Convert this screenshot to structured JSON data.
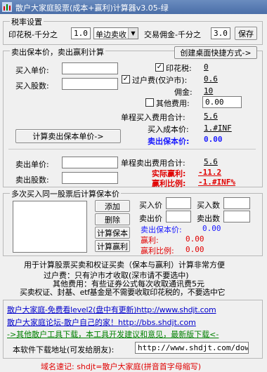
{
  "window": {
    "title": "散户大家庭股票(成本+赢利)计算器v3.05-绿"
  },
  "tax": {
    "group_label": "税率设置",
    "stamp_label": "印花税-千分之",
    "stamp_value": "1.0",
    "direction_selected": "单边卖收",
    "commission_label": "交易佣金-千分之",
    "commission_value": "3.0",
    "save_label": "保存"
  },
  "breakeven": {
    "group_label": "卖出保本价，卖出赢利计算",
    "shortcut_label": "创建桌面快捷方式->",
    "buy_price_label": "买入单价:",
    "buy_price_value": "",
    "buy_qty_label": "买入股数:",
    "buy_qty_value": "",
    "stamp_check_label": "印花税:",
    "stamp_amount": "0",
    "transfer_check_label": "过户费(仅沪市):",
    "transfer_amount": "0.6",
    "commission_label": "佣金:",
    "commission_amount": "10",
    "other_check_label": "其他费用:",
    "other_amount": "0.00",
    "unit_buy_fee_label": "单程买入费用合计:",
    "unit_buy_fee_value": "5.6",
    "buy_cost_label": "买入成本价:",
    "buy_cost_value": "1.#INF",
    "calc_button_label": "计算卖出保本单价->",
    "breakeven_label": "卖出保本价:",
    "breakeven_value": "0.00",
    "sell_price_label": "卖出单价:",
    "sell_price_value": "",
    "sell_qty_label": "卖出股数:",
    "sell_qty_value": "",
    "unit_sell_fee_label": "单程卖出费用合计:",
    "unit_sell_fee_value": "5.6",
    "actual_profit_label": "实际赢利:",
    "actual_profit_value": "-11.2",
    "profit_ratio_label": "赢利比例:",
    "profit_ratio_value": "-1.#INF%"
  },
  "multi": {
    "group_label": "多次买入同一股票后计算保本价",
    "add_label": "添加",
    "delete_label": "删除",
    "calc_breakeven_label": "计算保本",
    "calc_profit_label": "计算赢利",
    "buy_price_label": "买入价",
    "buy_qty_label": "买入数",
    "sell_price_label": "卖出价",
    "sell_qty_label": "卖出数",
    "sell_qty_value": "",
    "breakeven_label": "卖出保本价:",
    "breakeven_value": "0.00",
    "profit_label": "赢利:",
    "profit_value": "0.00",
    "ratio_label": "赢利比例:",
    "ratio_value": "0.00"
  },
  "info": {
    "line1": "用于计算股票买卖和权证买卖（保本与赢利）计算非常方便",
    "line2": "过户费：只有沪市才收取(深市请不要选中)",
    "line3": "其他费用：有些证券公式每次收取通讯费5元",
    "line4": "买卖权证、封基、etf基金是不需要收取印花税的，不要选中它"
  },
  "links": {
    "link1": "散户大家庭-免费看level2(盘中有更新)http://www.shdjt.com",
    "link2": "散户大家庭论坛-散户自己的家！http://bbs.shdjt.com",
    "link3": "->其他散户工具下载，本工具开发建议和意见，最新版下载<-"
  },
  "download": {
    "label": "本软件下载地址(可发给朋友):",
    "url": "http://www.shdjt.com/downl"
  },
  "footer": {
    "text": "域名速记: shdjt=散户大家庭(拼音首字母缩写)"
  },
  "colors": {
    "value_blue": "#1a1aff",
    "accent_red": "#e00000",
    "link_blue": "#0000cc"
  }
}
